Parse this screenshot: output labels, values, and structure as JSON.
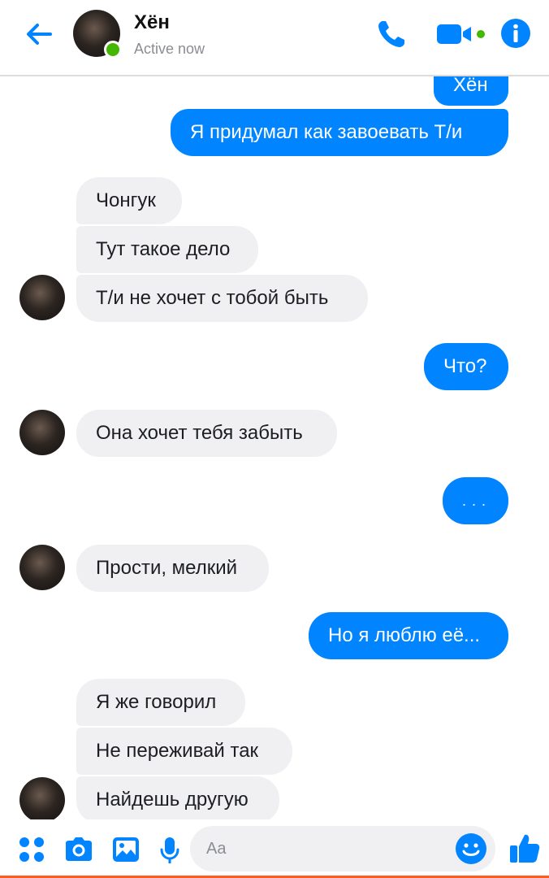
{
  "header": {
    "name": "Хён",
    "status": "Active now"
  },
  "messages": [
    {
      "dir": "out",
      "text": "Хён"
    },
    {
      "dir": "out",
      "text": "Я придумал как завоевать Т/и"
    },
    {
      "dir": "in",
      "text": "Чонгук"
    },
    {
      "dir": "in",
      "text": "Тут такое дело"
    },
    {
      "dir": "in",
      "text": "Т/и не хочет с тобой быть"
    },
    {
      "dir": "out",
      "text": "Что?"
    },
    {
      "dir": "in",
      "text": "Она хочет тебя забыть"
    },
    {
      "dir": "out",
      "text": ". . ."
    },
    {
      "dir": "in",
      "text": "Прости, мелкий"
    },
    {
      "dir": "out",
      "text": "Но я люблю её..."
    },
    {
      "dir": "in",
      "text": "Я же говорил"
    },
    {
      "dir": "in",
      "text": "Не переживай так"
    },
    {
      "dir": "in",
      "text": "Найдешь другую"
    }
  ],
  "composer": {
    "placeholder": "Aa"
  },
  "colors": {
    "accent": "#0084ff",
    "incoming_bubble": "#f0f0f3",
    "online": "#44b700"
  },
  "icons": [
    "back-arrow-icon",
    "phone-icon",
    "video-icon",
    "info-icon",
    "apps-icon",
    "camera-icon",
    "gallery-icon",
    "mic-icon",
    "emoji-icon",
    "thumbs-up-icon"
  ]
}
